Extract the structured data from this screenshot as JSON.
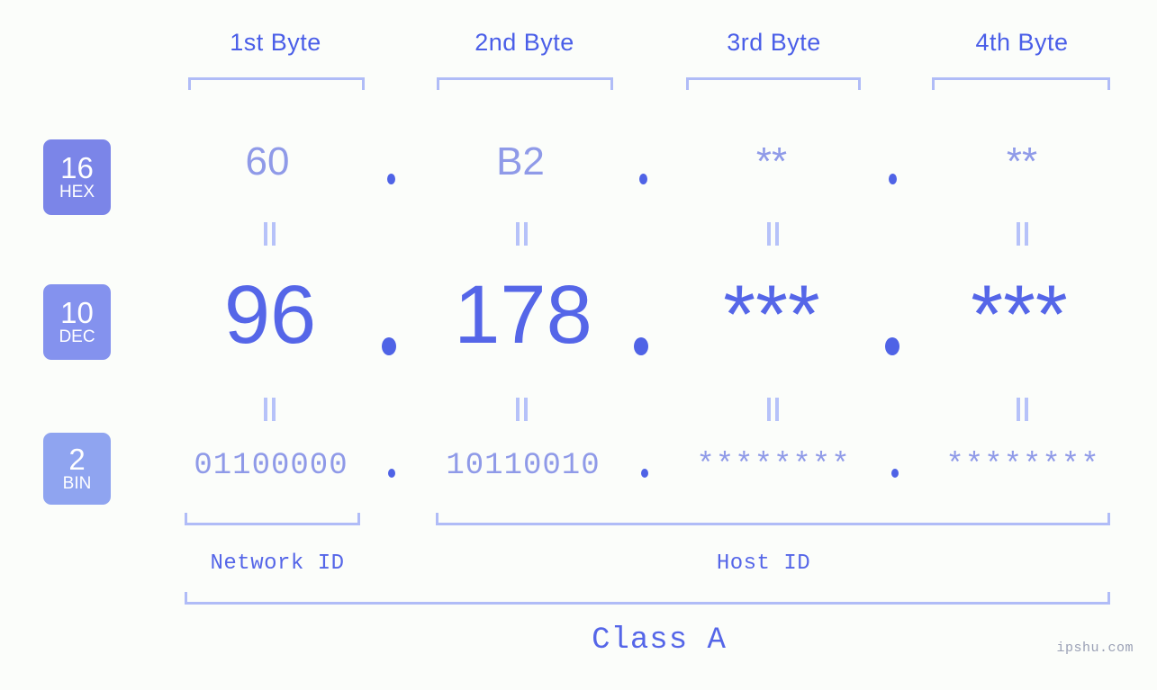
{
  "meta": {
    "watermark": "ipshu.com"
  },
  "byte_headers": [
    {
      "label": "1st Byte"
    },
    {
      "label": "2nd Byte"
    },
    {
      "label": "3rd Byte"
    },
    {
      "label": "4th Byte"
    }
  ],
  "radix_badges": [
    {
      "number": "16",
      "name": "HEX",
      "color": "#7b85e8"
    },
    {
      "number": "10",
      "name": "DEC",
      "color": "#8492ee"
    },
    {
      "number": "2",
      "name": "BIN",
      "color": "#8fa4f0"
    }
  ],
  "rows": {
    "hex": {
      "radix": "16",
      "radix_name": "HEX",
      "octets": [
        "60",
        "B2",
        "**",
        "**"
      ],
      "separator": "."
    },
    "dec": {
      "radix": "10",
      "radix_name": "DEC",
      "octets": [
        "96",
        "178",
        "***",
        "***"
      ],
      "separator": "."
    },
    "bin": {
      "radix": "2",
      "radix_name": "BIN",
      "octets": [
        "01100000",
        "10110010",
        "********",
        "********"
      ],
      "separator": "."
    }
  },
  "connectors": {
    "symbol": "||"
  },
  "sections": {
    "network_id": "Network ID",
    "host_id": "Host ID",
    "class": "Class A"
  },
  "colors": {
    "background": "#fbfdfa",
    "accent_strong": "#5566e8",
    "accent_light": "#8f9ae8",
    "bracket": "#b0bcf7",
    "connector": "#b6c2f9",
    "dot": "#4f63e6"
  }
}
